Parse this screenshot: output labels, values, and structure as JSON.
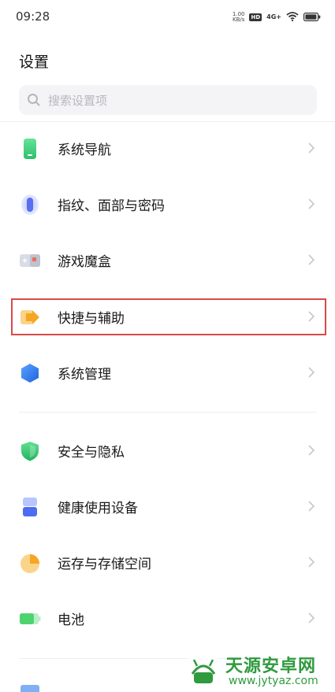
{
  "status": {
    "time": "09:28",
    "net_speed_value": "1.00",
    "net_speed_unit": "KB/s",
    "hd": "HD",
    "network": "4G+"
  },
  "page": {
    "title": "设置"
  },
  "search": {
    "placeholder": "搜索设置项"
  },
  "items": [
    {
      "label": "系统导航",
      "icon": "phone-navigation-icon"
    },
    {
      "label": "指纹、面部与密码",
      "icon": "fingerprint-icon"
    },
    {
      "label": "游戏魔盒",
      "icon": "game-box-icon"
    },
    {
      "label": "快捷与辅助",
      "icon": "shortcut-arrow-icon",
      "highlighted": true
    },
    {
      "label": "系统管理",
      "icon": "hexagon-icon"
    },
    {
      "label": "安全与隐私",
      "icon": "shield-icon"
    },
    {
      "label": "健康使用设备",
      "icon": "hourglass-icon"
    },
    {
      "label": "运存与存储空间",
      "icon": "pie-chart-icon"
    },
    {
      "label": "电池",
      "icon": "battery-icon"
    }
  ],
  "colors": {
    "highlight_border": "#d84a4a",
    "navigation_green": "#3ecf7a",
    "fingerprint_blue": "#5a6ef0",
    "shortcut_orange": "#f5a623",
    "management_blue": "#2d7cf0",
    "security_green": "#2fbf6a",
    "storage_orange": "#f5b241",
    "battery_green": "#4ed46e"
  },
  "watermark": {
    "brand": "天源安卓网",
    "url": "www.jytyaz.com"
  }
}
